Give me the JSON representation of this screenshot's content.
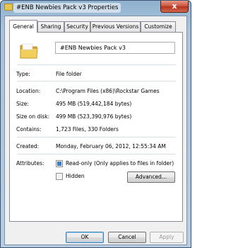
{
  "window": {
    "title": "#ENB Newbies Pack v3 Properties",
    "close_glyph": "x"
  },
  "tabs": [
    {
      "label": "General",
      "active": true
    },
    {
      "label": "Sharing",
      "active": false
    },
    {
      "label": "Security",
      "active": false
    },
    {
      "label": "Previous Versions",
      "active": false
    },
    {
      "label": "Customize",
      "active": false
    }
  ],
  "general": {
    "icon": "folder-icon",
    "name": "#ENB Newbies Pack v3",
    "rows": {
      "type": {
        "label": "Type:",
        "value": "File folder"
      },
      "location": {
        "label": "Location:",
        "value": "C:\\Program Files (x86)\\Rockstar Games"
      },
      "size": {
        "label": "Size:",
        "value": "495 MB (519,442,184 bytes)"
      },
      "size_on_disk": {
        "label": "Size on disk:",
        "value": "499 MB (523,390,976 bytes)"
      },
      "contains": {
        "label": "Contains:",
        "value": "1,723 Files, 330 Folders"
      },
      "created": {
        "label": "Created:",
        "value": "Monday, February 06, 2012, 12:55:34 AM"
      }
    },
    "attributes": {
      "label": "Attributes:",
      "readonly": {
        "label": "Read-only (Only applies to files in folder)",
        "state": "indeterminate"
      },
      "hidden": {
        "label": "Hidden",
        "checked": false
      },
      "advanced_label": "Advanced..."
    }
  },
  "buttons": {
    "ok": "OK",
    "cancel": "Cancel",
    "apply": "Apply"
  },
  "colors": {
    "accent": "#3e7ec8",
    "close": "#c75139"
  }
}
